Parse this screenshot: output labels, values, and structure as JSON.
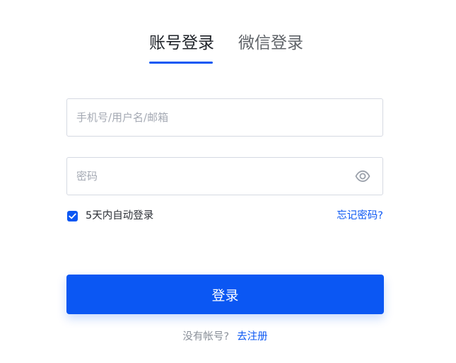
{
  "tabs": [
    {
      "label": "账号登录",
      "active": true
    },
    {
      "label": "微信登录",
      "active": false
    }
  ],
  "form": {
    "username": {
      "value": "",
      "placeholder": "手机号/用户名/邮箱"
    },
    "password": {
      "value": "",
      "placeholder": "密码"
    }
  },
  "remember": {
    "label": "5天内自动登录",
    "checked": true
  },
  "forgot_label": "忘记密码?",
  "login_label": "登录",
  "footer": {
    "question": "没有帐号?",
    "register_label": "去注册"
  },
  "colors": {
    "accent": "#0b57f3",
    "border": "#d5d9e2",
    "placeholder": "#a4a9b3",
    "muted": "#8a9099"
  },
  "icons": {
    "password_toggle": "eye-icon",
    "checkbox_mark": "check-icon"
  }
}
